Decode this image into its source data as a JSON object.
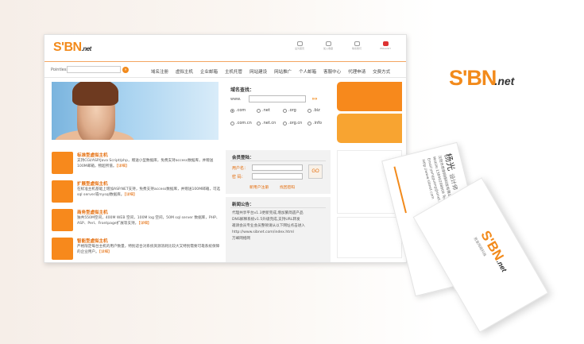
{
  "site": {
    "logo_mark": "S'BN",
    "logo_net": ".net",
    "top_icons": [
      {
        "icon": "home-icon",
        "label": "设为首页"
      },
      {
        "icon": "mail-icon",
        "label": "加入收藏"
      },
      {
        "icon": "contact-icon",
        "label": "联系我们"
      },
      {
        "icon": "flag-icon",
        "label": "ENGLISH"
      }
    ],
    "search_label": "Pointless",
    "search_go": "»",
    "nav": [
      "域名注册",
      "虚拟主机",
      "企业邮箱",
      "主机托管",
      "网站建设",
      "网站推广",
      "个人邮箱",
      "客服中心",
      "代理申请",
      "交费方式"
    ],
    "domain_title": "域名查找：",
    "www_label": "www.",
    "domain_go": "»»",
    "tlds": [
      ".com",
      ".net",
      ".org",
      ".biz",
      ".com.cn",
      ".net.cn",
      ".org.cn",
      ".info"
    ],
    "hosting": [
      {
        "title": "标准型虚拟主机",
        "desc": "支持CGI/ASP/Java Script/php，赠送小型数据库，免费支持access数据库，并赠送100M邮箱，物超所值。",
        "more": "【详细】"
      },
      {
        "title": "扩展型虚拟主机",
        "desc": "在标准主机基础上增加ASP.NET支持，免费支持access数据库，并赠送100M邮箱，可选sql server或mysql数据库。",
        "more": "【详细】"
      },
      {
        "title": "商务型虚拟主机",
        "desc": "独共550M空间，400M WEB 空间，100M log 空间，50M sql server 数据库，PHP、ASP、Perl、Frontpage扩展等支持。",
        "more": "【详细】"
      },
      {
        "title": "智能型虚拟主机",
        "desc": "严格限定每台主机的用户数量，特别适合对系统资源消耗比较大又特别需要可靠系统保障的企业用户。",
        "more": "【详细】"
      }
    ],
    "login": {
      "title": "会员登陆：",
      "user_label": "用户名：",
      "pass_label": "密 码：",
      "go": "GO",
      "register": "新用户注册",
      "forgot": "找回密码"
    },
    "news": {
      "title": "新闻公告：",
      "lines": [
        "代理共享平台v1.3更新完成,增加繁简遗产品",
        "DNS解释系统v1.5升级完成,支持URL转发",
        "邀请会员专业会员整顿请从以下网址点击进入",
        "http://www.sibnet.com/index.html",
        "万峰网络网"
      ]
    }
  },
  "brand": {
    "mark": "S'BN",
    "net": ".net"
  },
  "card_back": {
    "name": "杨光",
    "job": "设计师",
    "lines": [
      "沈阳市思泉网络科技有限公司",
      "Mobile:13840298809  Tel:+86-24-23681088",
      "Email:yangguang@sinet.edu.cn",
      "Http://www.sibnet.com"
    ]
  },
  "card_front": {
    "mark": "S'BN",
    "net": ".net",
    "sub": "思泉网络科技"
  }
}
